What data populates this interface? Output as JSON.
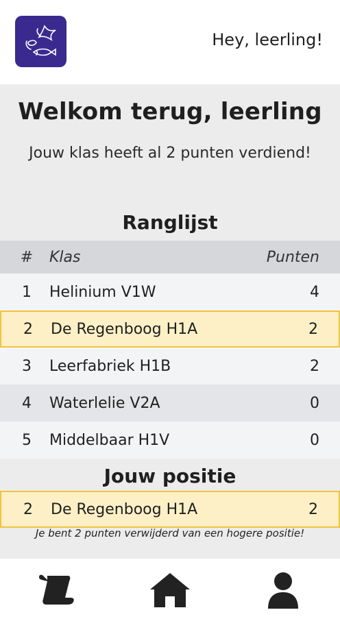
{
  "header": {
    "greeting": "Hey, leerling!",
    "logo_icon": "fish-bird-logo-icon",
    "logo_color": "#3a2a8f"
  },
  "welcome": {
    "title": "Welkom terug, leerling",
    "subtitle": "Jouw klas heeft al 2 punten verdiend!"
  },
  "leaderboard": {
    "title": "Ranglijst",
    "headers": {
      "rank": "#",
      "class": "Klas",
      "points": "Punten"
    },
    "rows": [
      {
        "rank": "1",
        "class": "Helinium V1W",
        "points": "4",
        "highlight": false
      },
      {
        "rank": "2",
        "class": "De Regenboog H1A",
        "points": "2",
        "highlight": true
      },
      {
        "rank": "3",
        "class": "Leerfabriek H1B",
        "points": "2",
        "highlight": false
      },
      {
        "rank": "4",
        "class": "Waterlelie V2A",
        "points": "0",
        "highlight": false
      },
      {
        "rank": "5",
        "class": "Middelbaar H1V",
        "points": "0",
        "highlight": false
      }
    ],
    "highlight_color": "#fdf0c6",
    "highlight_border": "#f2c23c"
  },
  "position": {
    "title": "Jouw positie",
    "rank": "2",
    "class": "De Regenboog H1A",
    "points": "2",
    "note": "Je bent 2 punten verwijderd van een hogere positie!"
  },
  "nav": {
    "items": [
      {
        "icon": "scroll-icon"
      },
      {
        "icon": "home-icon"
      },
      {
        "icon": "user-icon"
      }
    ]
  }
}
